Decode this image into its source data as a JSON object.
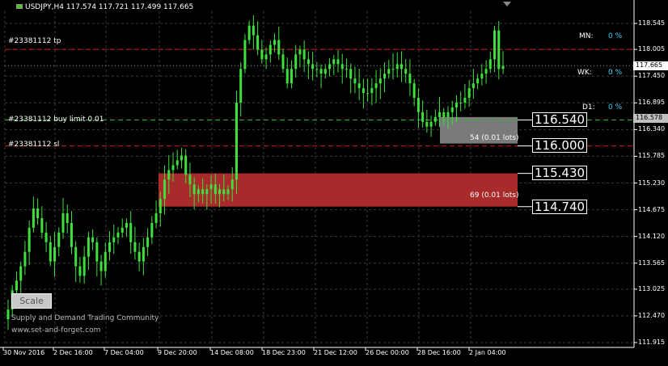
{
  "header": {
    "symbol_line": "USDJPY,H4  117.574 117.721 117.499 117.665"
  },
  "chart_data": {
    "type": "line",
    "symbol": "USDJPY",
    "timeframe": "H4",
    "ohlc_header": {
      "open": 117.574,
      "high": 117.721,
      "low": 117.499,
      "close": 117.665
    },
    "x_ticks": [
      "30 Nov 2016",
      "2 Dec 16:00",
      "7 Dec 04:00",
      "9 Dec 20:00",
      "14 Dec 08:00",
      "18 Dec 23:00",
      "21 Dec 12:00",
      "26 Dec 00:00",
      "28 Dec 16:00",
      "2 Jan 04:00"
    ],
    "y_ticks": [
      "118.545",
      "118.005",
      "117.450",
      "116.895",
      "116.340",
      "115.785",
      "115.230",
      "114.675",
      "114.120",
      "113.565",
      "113.025",
      "112.470",
      "111.915"
    ],
    "y_range": [
      111.915,
      118.545
    ],
    "close_series": [
      112.6,
      113.0,
      113.2,
      113.5,
      113.8,
      114.3,
      114.7,
      114.5,
      114.2,
      114.0,
      113.6,
      113.9,
      114.2,
      114.6,
      114.4,
      113.9,
      113.5,
      113.3,
      113.7,
      114.1,
      114.0,
      113.6,
      113.4,
      113.8,
      114.0,
      114.1,
      114.2,
      114.3,
      114.4,
      114.0,
      113.8,
      113.6,
      113.9,
      114.1,
      114.4,
      114.6,
      114.9,
      115.3,
      115.5,
      115.6,
      115.7,
      115.8,
      115.4,
      115.2,
      115.0,
      115.1,
      115.0,
      115.1,
      115.2,
      115.0,
      115.1,
      115.0,
      115.1,
      115.3,
      116.9,
      117.6,
      118.2,
      118.5,
      118.3,
      118.0,
      117.8,
      117.9,
      118.1,
      118.2,
      117.9,
      117.6,
      117.3,
      117.6,
      117.9,
      118.0,
      117.8,
      117.7,
      117.6,
      117.6,
      117.5,
      117.6,
      117.7,
      117.8,
      117.7,
      117.6,
      117.6,
      117.4,
      117.3,
      117.2,
      117.1,
      117.1,
      117.2,
      117.3,
      117.4,
      117.5,
      117.6,
      117.6,
      117.7,
      117.6,
      117.5,
      117.3,
      117.0,
      116.7,
      116.5,
      116.4,
      116.5,
      116.6,
      116.7,
      116.6,
      116.7,
      116.8,
      116.9,
      116.9,
      117.0,
      117.2,
      117.3,
      117.4,
      117.5,
      117.6,
      117.8,
      118.4,
      117.6,
      117.665
    ],
    "current_price": "117.665",
    "right_tags": [
      {
        "text": "117.665",
        "value": 117.665,
        "bg": "#ffffff",
        "fg": "#000000"
      },
      {
        "text": "116.578",
        "value": 116.578,
        "bg": "#c0c0c0",
        "fg": "#000000"
      }
    ],
    "horizontal_lines": [
      {
        "label": "#23381112 tp",
        "value": 118.005,
        "color": "#d11a1a",
        "style": "dashed"
      },
      {
        "label": "#23381112 buy limit 0.01",
        "value": 116.54,
        "color": "#2db52d",
        "style": "dashed"
      },
      {
        "label": "#23381112 sl",
        "value": 116.0,
        "color": "#d11a1a",
        "style": "dashed"
      }
    ],
    "zones": [
      {
        "id": "supply",
        "top": 116.6,
        "bottom": 116.05,
        "color": "#7a7a7a",
        "label": "54 (0.01 lots)"
      },
      {
        "id": "demand",
        "top": 115.43,
        "bottom": 114.74,
        "color": "#a82a2a",
        "label": "69 (0.01 lots)"
      }
    ],
    "zone_price_labels": [
      "116.540",
      "116.000",
      "115.430",
      "114.740"
    ],
    "grid": true,
    "grid_color": "#3a3a3a",
    "candle_color": "#3ee03e"
  },
  "indicator": {
    "mn_label": "MN:",
    "mn_value": "0 %",
    "wk_label": "WK:",
    "wk_value": "0 %",
    "d1_label": "D1:",
    "d1_value": "0 %"
  },
  "scale_button": "Scale",
  "watermark": {
    "line1": "Supply and Demand Trading Community",
    "line2": "www.set-and-forget.com"
  }
}
